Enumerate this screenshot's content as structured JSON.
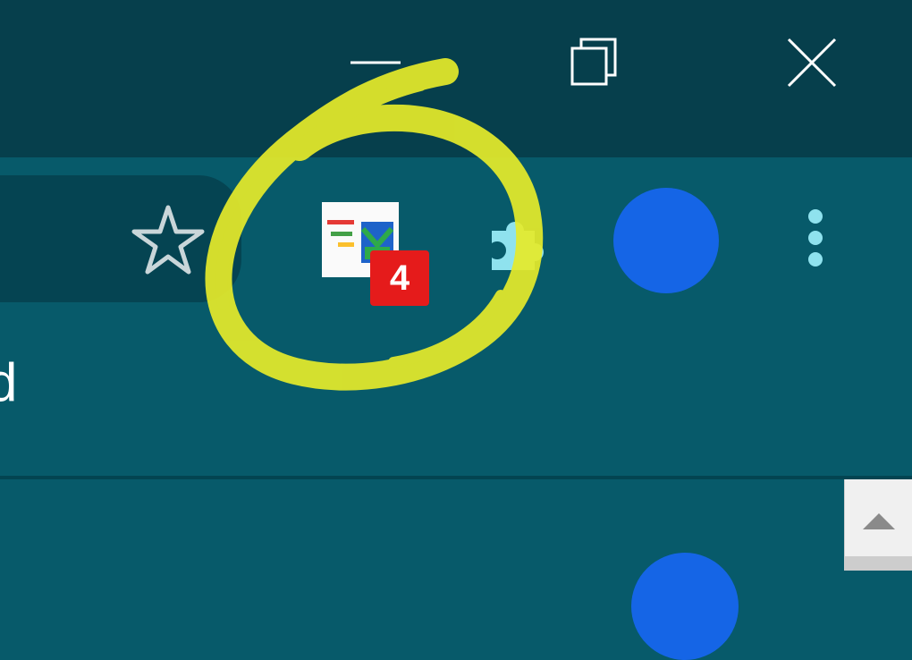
{
  "window_controls": {
    "minimize_icon": "minimize-icon",
    "maximize_icon": "restore-icon",
    "close_icon": "close-icon"
  },
  "toolbar": {
    "bookmark_icon": "star-icon",
    "extension": {
      "icon": "google-tasks-extension-icon",
      "badge_count": "4",
      "badge_color": "#e51b1b"
    },
    "extensions_icon": "puzzle-icon",
    "profile_color": "#1565e6",
    "menu_icon": "kebab-menu-icon"
  },
  "content": {
    "edge_text": "d"
  },
  "annotation": {
    "color": "#e6eb2a"
  },
  "colors": {
    "titlebar": "#063f4c",
    "toolbar": "#075a6a",
    "omnibox": "#054452"
  }
}
